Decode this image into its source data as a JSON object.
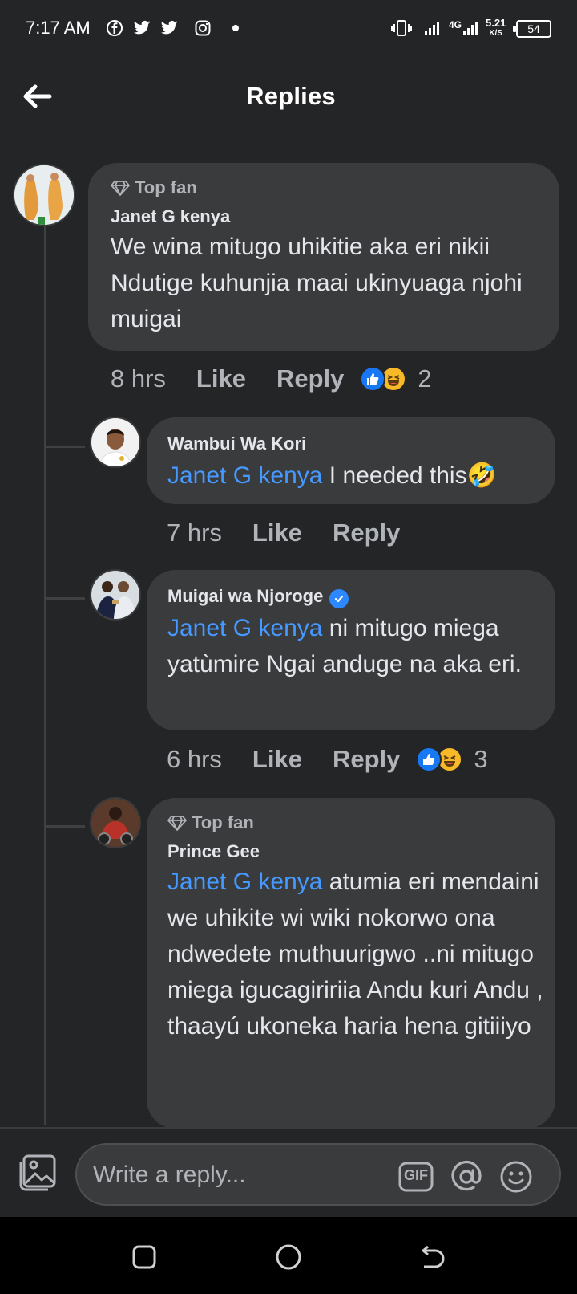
{
  "status_bar": {
    "time": "7:17 AM",
    "network": "4G",
    "speed_value": "5.21",
    "speed_unit": "K/S",
    "battery": "54"
  },
  "header": {
    "title": "Replies"
  },
  "comment": {
    "badge": "Top fan",
    "author": "Janet G kenya",
    "text": "We wina mitugo uhikitie aka eri nikii Ndutige kuhunjia maai ukinyuaga njohi muigai",
    "time": "8 hrs",
    "like_label": "Like",
    "reply_label": "Reply",
    "reaction_count": "2"
  },
  "replies": [
    {
      "author": "Wambui Wa Kori",
      "mention": "Janet G kenya",
      "text": " I needed this🤣",
      "time": "7 hrs",
      "like_label": "Like",
      "reply_label": "Reply"
    },
    {
      "author": "Muigai wa Njoroge",
      "mention": "Janet G kenya",
      "text": " ni mitugo miega yatùmire Ngai anduge na aka eri.",
      "time": "6 hrs",
      "like_label": "Like",
      "reply_label": "Reply",
      "reaction_count": "3"
    },
    {
      "badge": "Top fan",
      "author": "Prince Gee",
      "mention": "Janet G kenya",
      "text": " atumia eri mendaini we uhikite wi wiki nokorwo ona ndwedete muthuurigwo ..ni mitugo miega igucagiririia Andu kuri Andu , thaayú ukoneka haria hena gitiiiyo"
    }
  ],
  "composer": {
    "placeholder": "Write a reply...",
    "gif_label": "GIF"
  },
  "colors": {
    "background": "#242526",
    "bubble": "#3a3b3c",
    "mention": "#4599ff",
    "secondary_text": "#b0b3b8"
  }
}
